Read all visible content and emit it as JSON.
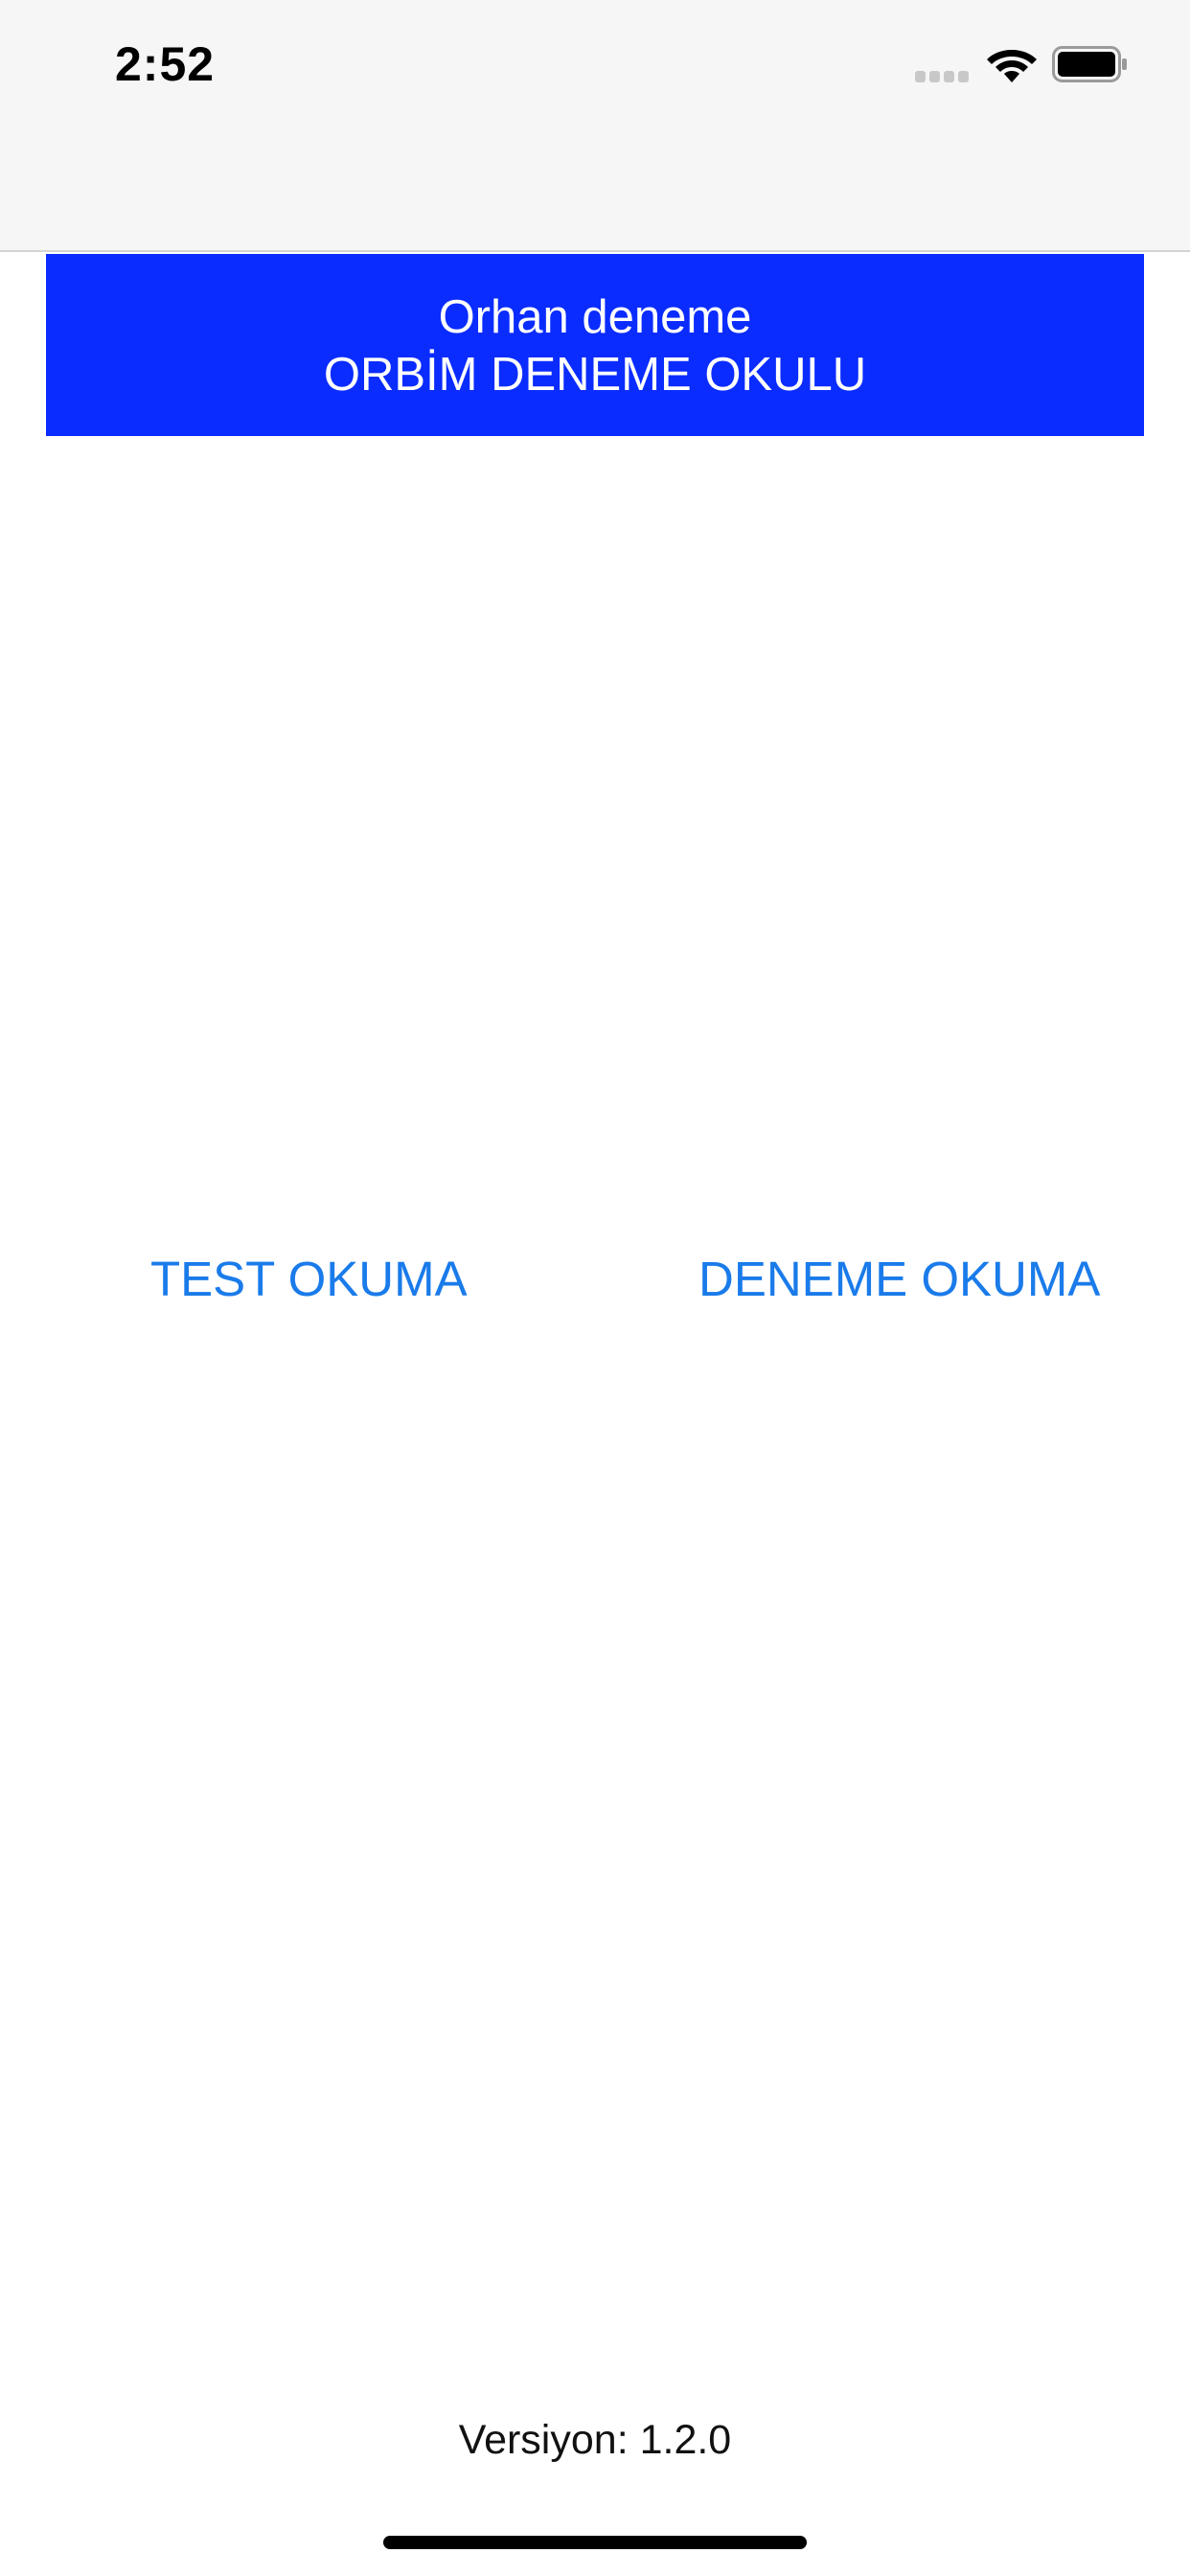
{
  "status_bar": {
    "time": "2:52",
    "icons": [
      "cellular-signal-icon",
      "wifi-icon",
      "battery-icon"
    ]
  },
  "header": {
    "title": "Orhan deneme",
    "subtitle": "ORBİM DENEME OKULU",
    "background_color": "#0a2cff",
    "text_color": "#ffffff"
  },
  "actions": {
    "test_label": "TEST OKUMA",
    "deneme_label": "DENEME OKUMA",
    "link_color": "#1a7bea"
  },
  "footer": {
    "version": "Versiyon: 1.2.0"
  }
}
